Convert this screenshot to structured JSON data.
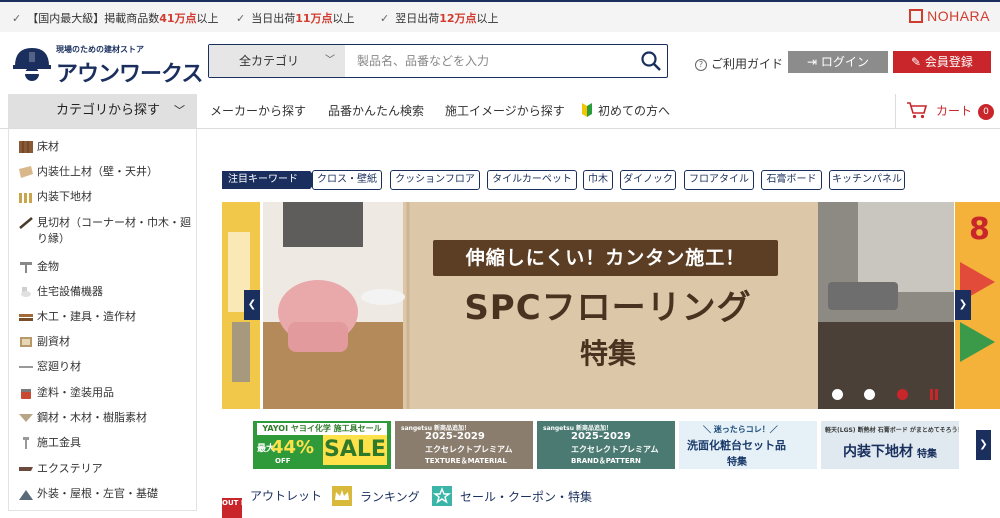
{
  "topbar": {
    "items": [
      {
        "pre": "【国内最大級】掲載商品数",
        "em": "41万点",
        "post": "以上"
      },
      {
        "pre": "当日出荷",
        "em": "11万点",
        "post": "以上"
      },
      {
        "pre": "翌日出荷",
        "em": "12万点",
        "post": "以上"
      }
    ],
    "brand": "NOHARA"
  },
  "logo": {
    "tagline": "現場のための建材ストア",
    "name": "アウンワークス"
  },
  "search": {
    "category": "全カテゴリ",
    "placeholder": "製品名、品番などを入力"
  },
  "header": {
    "guide": "ご利用ガイド",
    "login": "ログイン",
    "register": "会員登録"
  },
  "nav": {
    "category_button": "カテゴリから探す",
    "links": [
      "メーカーから探す",
      "品番かんたん検索",
      "施工イメージから探す",
      "初めての方へ"
    ],
    "cart_label": "カート",
    "cart_count": "0"
  },
  "sidebar": {
    "items": [
      "床材",
      "内装仕上材（壁・天井）",
      "内装下地材",
      "見切材（コーナー材・巾木・廻り縁）",
      "金物",
      "住宅設備機器",
      "木工・建具・造作材",
      "副資材",
      "窓廻り材",
      "塗料・塗装用品",
      "鋼材・木材・樹脂素材",
      "施工金具",
      "エクステリア",
      "外装・屋根・左官・基礎"
    ]
  },
  "keywords": {
    "heading": "注目キーワード",
    "chips": [
      "クロス・壁紙",
      "クッションフロア",
      "タイルカーペット",
      "巾木",
      "ダイノック",
      "フロアタイル",
      "石膏ボード",
      "キッチンパネル"
    ]
  },
  "banner": {
    "tag": "伸縮しにくい！カンタン施工！",
    "title": "SPCフローリング",
    "subtitle": "特集",
    "far_right_text": "8"
  },
  "promos": [
    {
      "line1": "YAYOI ヤヨイ化学 施工具セール",
      "line2": "最大",
      "line3": "44%",
      "line4": "OFF",
      "line5": "SALE"
    },
    {
      "line1": "sangetsu 新商品追加！",
      "line2": "2025-2029",
      "line3": "エクセレクトプレミアム",
      "line4": "TEXTURE＆MATERIAL"
    },
    {
      "line1": "sangetsu 新商品追加！",
      "line2": "2025-2029",
      "line3": "エクセレクトプレミアム",
      "line4": "BRAND＆PATTERN"
    },
    {
      "line1": "＼ 迷ったらコレ！／",
      "line2": "洗面化粧台セット品",
      "line3": "特集"
    },
    {
      "line1": "軽天(LGS) 断熱材 石膏ボード がまとめてそろう！",
      "line2": "内装下地材",
      "line3": "特集"
    }
  ],
  "bottom_links": [
    {
      "badge": "OUT LET",
      "label": "アウトレット"
    },
    {
      "badge": "",
      "label": "ランキング"
    },
    {
      "badge": "",
      "label": "セール・クーポン・特集"
    }
  ],
  "colors": {
    "navy": "#1a2f5e",
    "red": "#c8262b",
    "accent": "#d23c2f"
  }
}
